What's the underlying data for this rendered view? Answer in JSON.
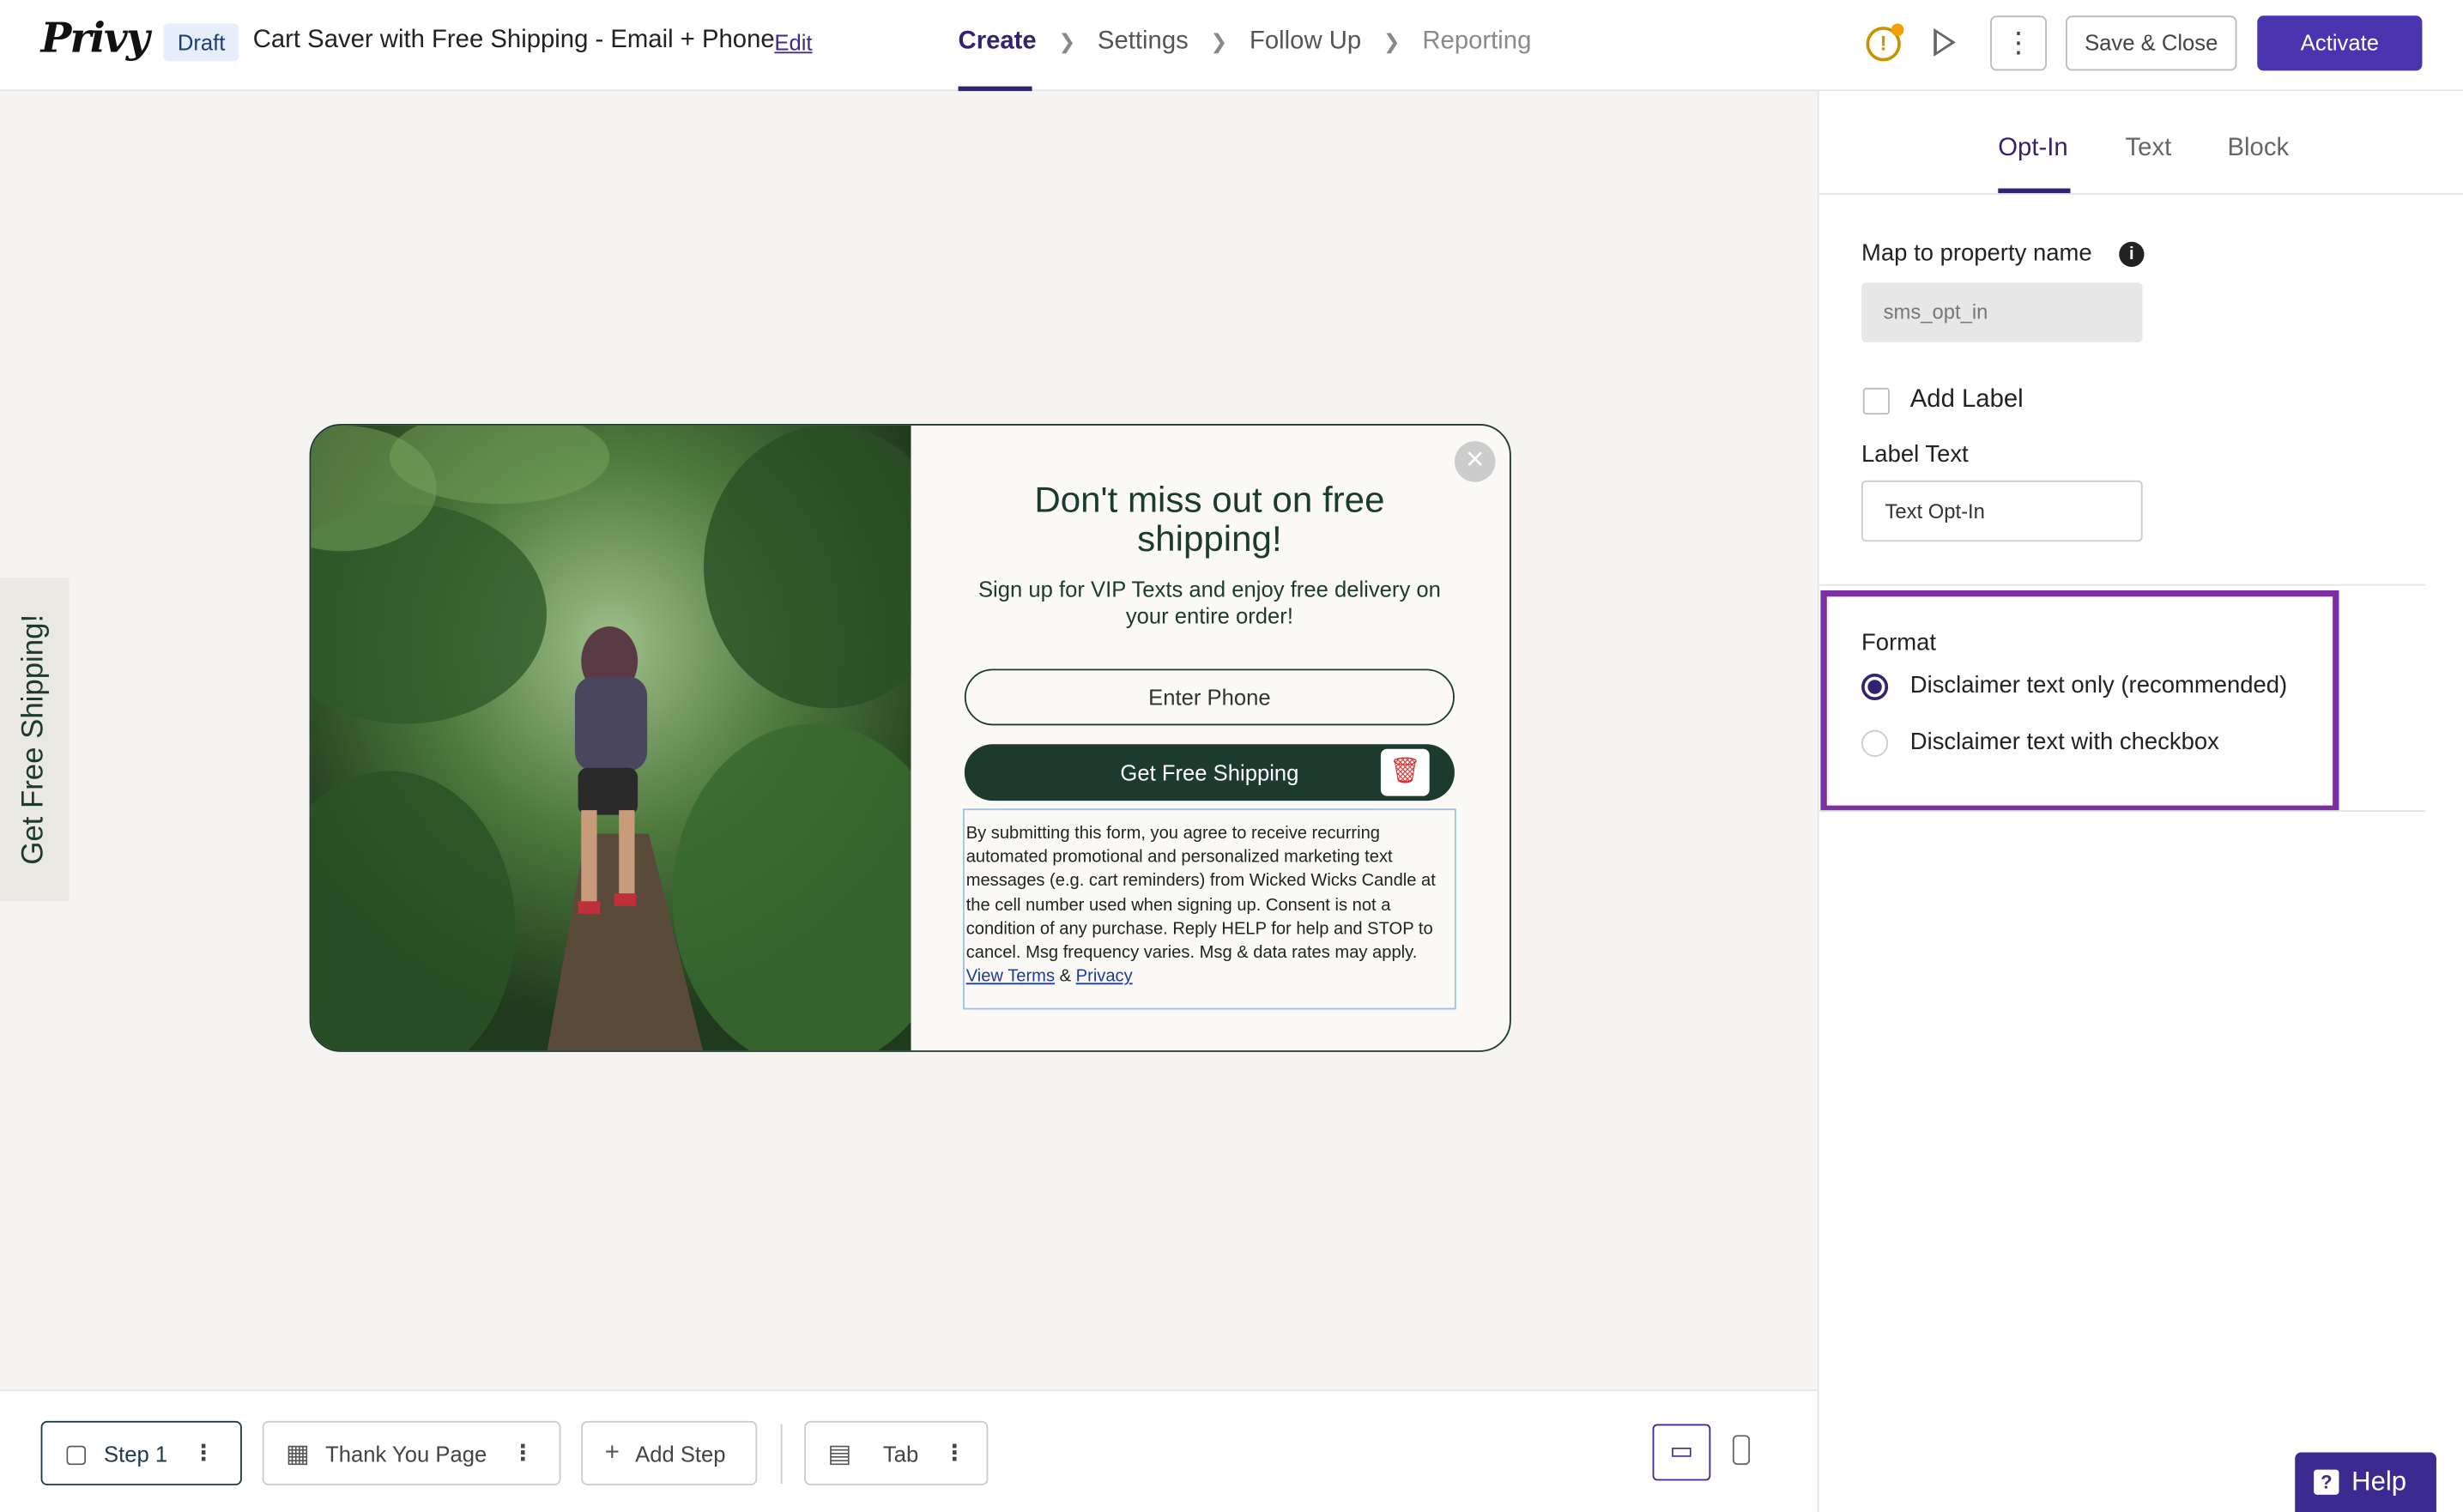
{
  "header": {
    "logo": "Privy",
    "status_badge": "Draft",
    "campaign_title": "Cart Saver with Free Shipping - Email + Phone",
    "edit_label": "Edit",
    "steps": [
      {
        "label": "Create"
      },
      {
        "label": "Settings"
      },
      {
        "label": "Follow Up"
      },
      {
        "label": "Reporting"
      }
    ],
    "save_close_label": "Save & Close",
    "activate_label": "Activate",
    "warning_glyph": "!",
    "kebab_glyph": "⋮"
  },
  "side_tab": {
    "label": "Get Free Shipping!"
  },
  "popup": {
    "close_glyph": "×",
    "title": "Don't miss out on free shipping!",
    "subtitle": "Sign up for VIP Texts and enjoy free delivery on your entire order!",
    "phone_placeholder": "Enter Phone",
    "button_label": "Get Free Shipping",
    "disclaimer_text": "By submitting this form, you agree to receive recurring automated promotional and personalized marketing text messages (e.g. cart reminders) from Wicked Wicks Candle at the cell number used when signing up. Consent is not a condition of any purchase. Reply HELP for help and STOP to cancel. Msg frequency varies. Msg & data rates may apply.",
    "terms_link": "View Terms",
    "ampersand": "&",
    "privacy_link": "Privacy"
  },
  "bottom_bar": {
    "step1": "Step 1",
    "thank_you": "Thank You Page",
    "add_step": "Add Step",
    "tab": "Tab"
  },
  "panel": {
    "tabs": [
      {
        "label": "Opt-In"
      },
      {
        "label": "Text"
      },
      {
        "label": "Block"
      }
    ],
    "map_label": "Map to property name",
    "property_value": "sms_opt_in",
    "add_label": "Add Label",
    "label_text_heading": "Label Text",
    "label_text_value": "Text Opt-In",
    "format_heading": "Format",
    "format_options": [
      {
        "label": "Disclaimer text only (recommended)",
        "selected": true
      },
      {
        "label": "Disclaimer text with checkbox",
        "selected": false
      }
    ]
  },
  "help": {
    "label": "Help"
  },
  "colors": {
    "accent": "#4a34b0",
    "brand_green": "#1d3a2e",
    "highlight": "#7b2fa0"
  }
}
